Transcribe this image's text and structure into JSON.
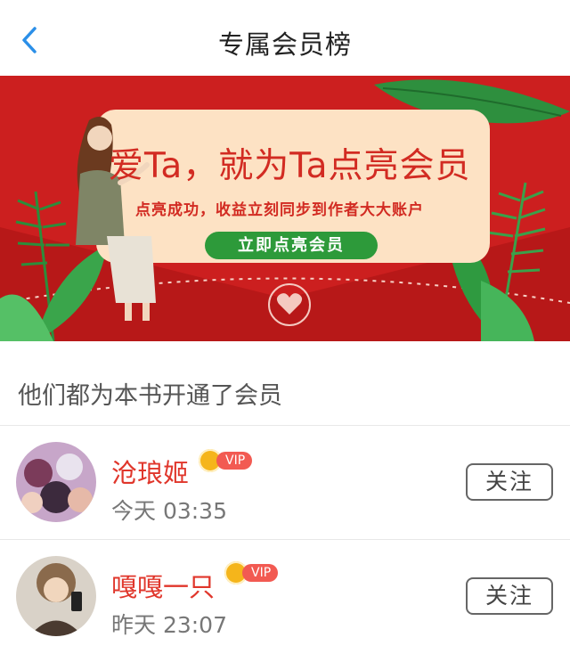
{
  "header": {
    "title": "专属会员榜",
    "back_icon": "chevron-left-icon"
  },
  "banner": {
    "headline": "爱Ta，就为Ta点亮会员",
    "subline": "点亮成功，收益立刻同步到作者大大账户",
    "cta_label": "立即点亮会员",
    "colors": {
      "background": "#cc1f1f",
      "card": "#fde2c4",
      "accent_text": "#d22b22",
      "cta": "#2d9a3a"
    }
  },
  "section_title": "他们都为本书开通了会员",
  "members": [
    {
      "name": "沧琅姬",
      "badge": "VIP",
      "time": "今天 03:35",
      "follow_label": "关注"
    },
    {
      "name": "嘎嘎一只",
      "badge": "VIP",
      "time": "昨天 23:07",
      "follow_label": "关注"
    }
  ],
  "colors": {
    "name": "#e0362b",
    "vip_pill": "#f25a52",
    "crown": "#f5b51b",
    "back_arrow": "#2b8fe8"
  }
}
